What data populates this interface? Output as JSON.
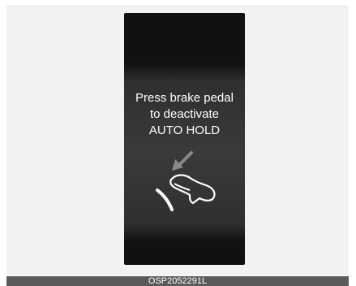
{
  "display": {
    "message_lines": [
      "Press brake pedal",
      "to deactivate",
      "AUTO HOLD"
    ],
    "icon": "foot-pressing-brake-pedal-icon"
  },
  "caption": {
    "code": "OSP2052291L"
  },
  "colors": {
    "display_bg": "#111111",
    "band": "#3a3a3a",
    "text": "#ffffff",
    "caption_bar": "#5a5a5a",
    "frame": "#f2f2f2"
  }
}
